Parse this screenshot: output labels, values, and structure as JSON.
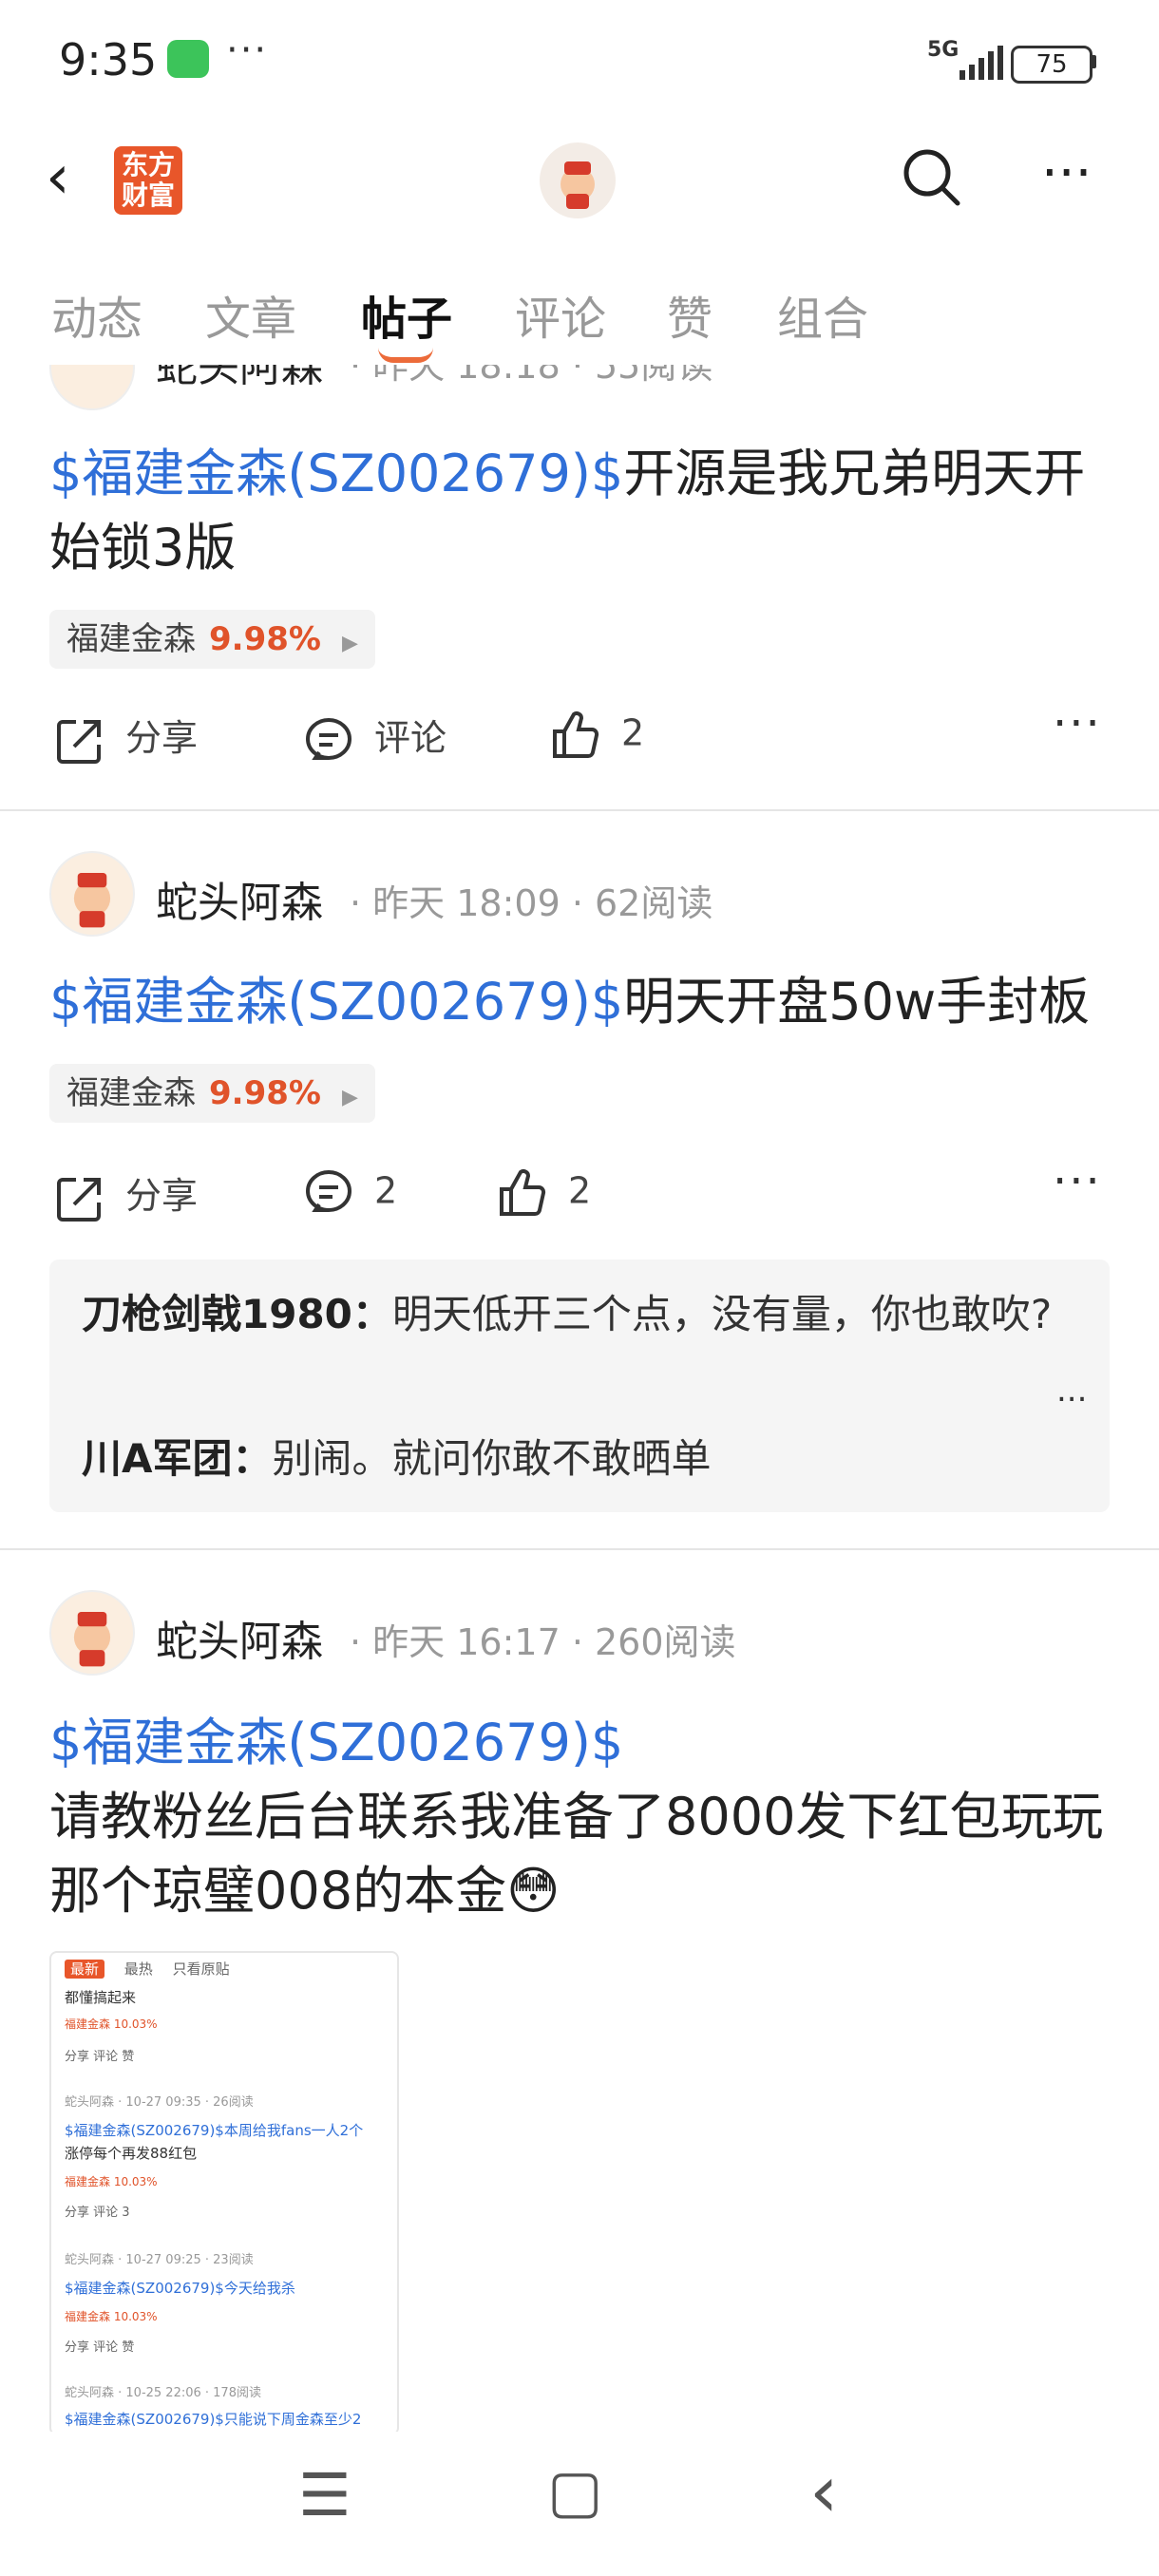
{
  "status_bar": {
    "time": "9:35",
    "dots": "···",
    "network": "5G",
    "battery": "75"
  },
  "header": {
    "logo_text": "东方财富"
  },
  "tabs": [
    "动态",
    "文章",
    "帖子",
    "评论",
    "赞",
    "组合"
  ],
  "active_tab": "帖子",
  "post1": {
    "author_partial": "蛇头阿森",
    "meta_partial": "· 昨天 18:18 · 55阅读",
    "cashtag": "$福建金森(SZ002679)$",
    "text": "开源是我兄弟明天开始锁3版",
    "stock": {
      "name": "福建金森",
      "pct": "9.98%"
    },
    "actions": {
      "share": "分享",
      "comment": "评论",
      "likes": "2"
    }
  },
  "post2": {
    "author": "蛇头阿森",
    "meta": "· 昨天 18:09 · 62阅读",
    "cashtag": "$福建金森(SZ002679)$",
    "text": "明天开盘50w手封板",
    "stock": {
      "name": "福建金森",
      "pct": "9.98%"
    },
    "actions": {
      "share": "分享",
      "comments": "2",
      "likes": "2"
    },
    "comments": [
      {
        "user": "刀枪剑戟1980：",
        "text": "明天低开三个点，没有量，你也敢吹?"
      },
      {
        "user": "川A军团：",
        "text": "别闹。就问你敢不敢晒单"
      }
    ],
    "comments_more": "..."
  },
  "post3": {
    "author": "蛇头阿森",
    "meta": "· 昨天 16:17 · 260阅读",
    "cashtag": "$福建金森(SZ002679)$",
    "text": "请教粉丝后台联系我准备了8000发下红包玩玩那个琼璧008的本金",
    "emoji": "😳",
    "thumb": {
      "tabs": [
        "最新",
        "最热",
        "只看原贴"
      ],
      "lines": [
        "都懂搞起来",
        "福建金森 10.03%",
        "分享   评论   赞",
        "蛇头阿森 · 10-27 09:35 · 26阅读",
        "$福建金森(SZ002679)$本周给我fans一人2个",
        "涨停每个再发88红包",
        "福建金森 10.03%",
        "分享   评论   3",
        "蛇头阿森 · 10-27 09:25 · 23阅读",
        "$福建金森(SZ002679)$今天给我杀",
        "福建金森 10.03%",
        "分享   评论   赞",
        "蛇头阿森 · 10-25 22:06 · 178阅读",
        "$福建金森(SZ002679)$只能说下周金森至少2"
      ]
    }
  },
  "nav": {
    "menu": "☰",
    "home": "▢",
    "back": "‹"
  }
}
